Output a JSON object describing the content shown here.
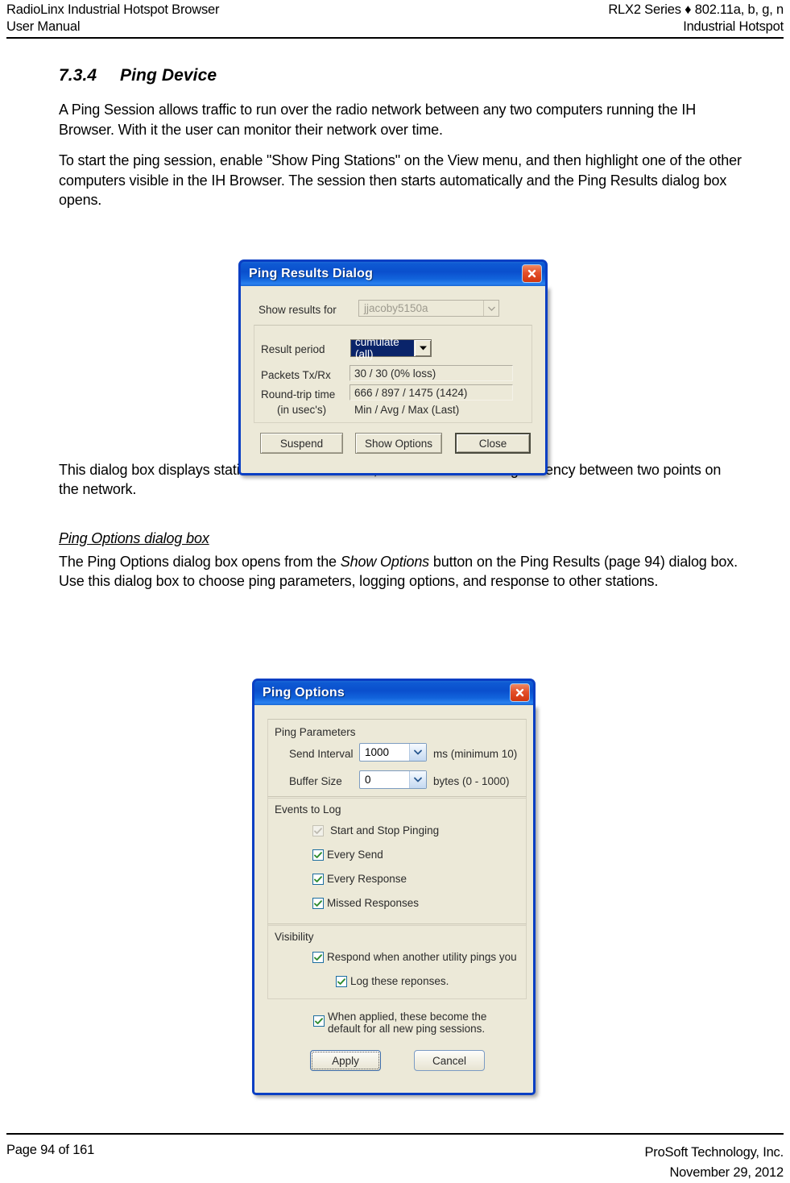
{
  "header": {
    "left_line1": "RadioLinx Industrial Hotspot Browser",
    "left_line2": "User Manual",
    "right_line1": "RLX2 Series ♦ 802.11a, b, g, n",
    "right_line2": "Industrial Hotspot"
  },
  "section": {
    "number": "7.3.4",
    "title": "Ping Device",
    "paragraph1": "A Ping Session allows traffic to run over the radio network between any two computers running the IH Browser. With it the user can monitor their network over time.",
    "paragraph2": "To start the ping session, enable \"Show Ping Stations\" on the View menu, and then highlight one of the other computers visible in the IH Browser. The session then starts automatically and the Ping Results dialog box opens.",
    "paragraph3": "This dialog box displays statistics on the minimum, maximum and average latency between two points on the network.",
    "subhead": "Ping Options dialog box",
    "paragraph4_a": "The Ping Options dialog box opens from the ",
    "paragraph4_em": "Show Options",
    "paragraph4_b": " button on the Ping Results (page 94) dialog box. Use this dialog box to choose ping parameters, logging options, and response to other stations."
  },
  "ping_results_dialog": {
    "title": "Ping Results Dialog",
    "close_tooltip": "Close",
    "show_results_for_label": "Show results for",
    "show_results_for_value": "jjacoby5150a",
    "result_period_label": "Result period",
    "result_period_value": "cumulate (all)",
    "packets_label": "Packets Tx/Rx",
    "packets_value": "30 / 30  (0% loss)",
    "roundtrip_label": "Round-trip time",
    "roundtrip_label2": "(in usec's)",
    "roundtrip_value": "666 / 897 / 1475 (1424)",
    "roundtrip_legend": "Min  / Avg  / Max   (Last)",
    "suspend_button": "Suspend",
    "show_options_button": "Show Options",
    "close_button": "Close"
  },
  "ping_options_dialog": {
    "title": "Ping Options",
    "close_tooltip": "Close",
    "ping_parameters_group": "Ping Parameters",
    "send_interval_label": "Send Interval",
    "send_interval_value": "1000",
    "send_interval_units": "ms (minimum  10)",
    "buffer_size_label": "Buffer Size",
    "buffer_size_value": "0",
    "buffer_size_units": "bytes (0 - 1000)",
    "events_group": "Events to Log",
    "events": [
      {
        "label": "Start and Stop Pinging",
        "checked": true,
        "disabled": true
      },
      {
        "label": "Every Send",
        "checked": true,
        "disabled": false
      },
      {
        "label": "Every Response",
        "checked": true,
        "disabled": false
      },
      {
        "label": "Missed Responses",
        "checked": true,
        "disabled": false
      }
    ],
    "visibility_group": "Visibility",
    "visibility": [
      {
        "label": "Respond when another utility pings you",
        "checked": true
      },
      {
        "label": "Log these reponses.",
        "checked": true
      }
    ],
    "default_checkbox_line1": "When applied, these become the",
    "default_checkbox_line2": "default for all new ping sessions.",
    "apply_button": "Apply",
    "cancel_button": "Cancel"
  },
  "footer": {
    "left": "Page 94 of 161",
    "right_line1": "ProSoft Technology, Inc.",
    "right_line2": "November 29, 2012"
  },
  "colors": {
    "title_bar_blue": "#0a4fcd",
    "dialog_face": "#ece9d8",
    "close_red": "#e4502a",
    "selection_blue": "#0a246a",
    "check_green": "#2e8b2e"
  }
}
